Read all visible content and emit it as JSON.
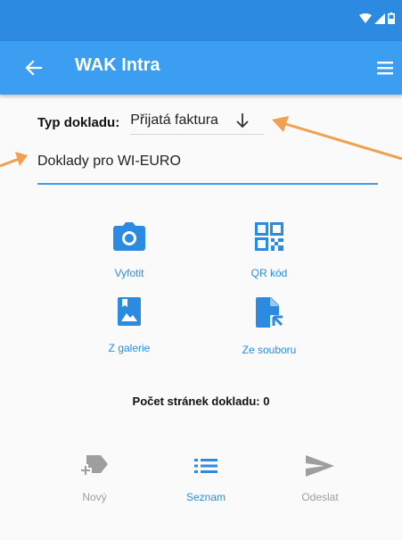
{
  "app": {
    "title": "WAK Intra"
  },
  "doc_type": {
    "label": "Typ dokladu:",
    "value": "Přijatá faktura"
  },
  "input": {
    "value": "Doklady pro WI-EURO"
  },
  "actions": {
    "photo": "Vyfotit",
    "qr": "QR kód",
    "gallery": "Z galerie",
    "file": "Ze souboru"
  },
  "pages_info": "Počet stránek dokladu: 0",
  "bottom_nav": {
    "new": "Nový",
    "list": "Seznam",
    "send": "Odeslat"
  },
  "colors": {
    "statusbar": "#2c8be0",
    "appbar": "#3b9ef0",
    "accent": "#2c8be0",
    "disabled": "#9e9e9e",
    "annotation_arrow": "#f0a050"
  }
}
